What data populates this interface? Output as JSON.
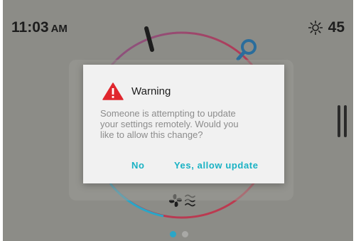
{
  "status_bar": {
    "time": "11:03",
    "ampm": "AM",
    "weather_icon": "sun-icon",
    "temperature": "45"
  },
  "thermostat": {
    "fan_icon": "fan-icon",
    "heat_icon": "heat-waves-icon",
    "page_count": 2,
    "active_page": 1,
    "colors": {
      "cool": "#2aa6c7",
      "heat": "#c0394c"
    }
  },
  "dialog": {
    "icon": "warning-icon",
    "icon_color": "#e0262d",
    "title": "Warning",
    "message_lines": [
      "Someone is attempting to update",
      "your settings remotely. Would you",
      "like to allow this change?"
    ],
    "button_no": "No",
    "button_yes": "Yes, allow update",
    "accent_color": "#19b2c4"
  }
}
